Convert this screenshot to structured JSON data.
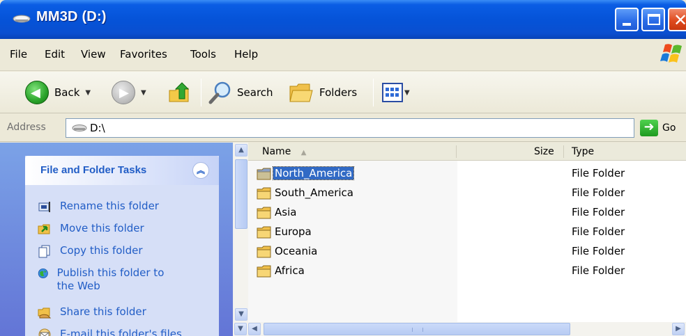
{
  "window": {
    "title": "MM3D (D:)"
  },
  "menu": [
    "File",
    "Edit",
    "View",
    "Favorites",
    "Tools",
    "Help"
  ],
  "toolbar": {
    "back_label": "Back",
    "search_label": "Search",
    "folders_label": "Folders"
  },
  "address": {
    "label": "Address",
    "path": "D:\\",
    "go_label": "Go"
  },
  "tasks": {
    "header": "File and Folder Tasks",
    "items": [
      {
        "label": "Rename this folder",
        "icon": "rename-icon"
      },
      {
        "label": "Move this folder",
        "icon": "move-icon"
      },
      {
        "label": "Copy this folder",
        "icon": "copy-icon"
      },
      {
        "label": "Publish this folder to the Web",
        "icon": "publish-web-icon"
      },
      {
        "label": "Share this folder",
        "icon": "share-icon"
      },
      {
        "label": "E-mail this folder's files",
        "icon": "email-icon"
      }
    ]
  },
  "columns": {
    "name": "Name",
    "size": "Size",
    "type": "Type"
  },
  "files": [
    {
      "name": "North_America",
      "type": "File Folder",
      "selected": true
    },
    {
      "name": "South_America",
      "type": "File Folder"
    },
    {
      "name": "Asia",
      "type": "File Folder"
    },
    {
      "name": "Europa",
      "type": "File Folder"
    },
    {
      "name": "Oceania",
      "type": "File Folder"
    },
    {
      "name": "Africa",
      "type": "File Folder"
    }
  ],
  "colors": {
    "title_bar": "#0553d8",
    "task_link": "#215dc6",
    "selection": "#316ac5",
    "close_button": "#df4b1f"
  }
}
